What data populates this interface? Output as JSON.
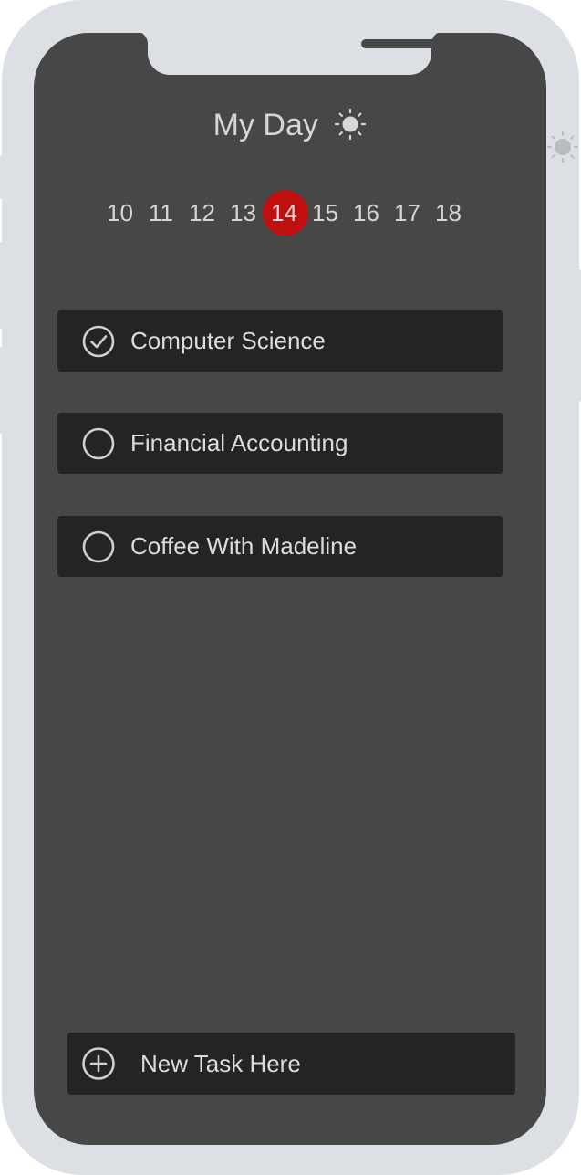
{
  "header": {
    "title": "My Day",
    "title_icon": "sun-icon"
  },
  "dates": {
    "days": [
      "10",
      "11",
      "12",
      "13",
      "14",
      "15",
      "16",
      "17",
      "18"
    ],
    "selected": "14",
    "selected_color": "#c00f0f"
  },
  "tasks": [
    {
      "label": "Computer Science",
      "done": true,
      "icon": "check-circle-icon"
    },
    {
      "label": "Financial Accounting",
      "done": false,
      "icon": "empty-circle-icon"
    },
    {
      "label": "Coffee With Madeline",
      "done": false,
      "icon": "empty-circle-icon"
    }
  ],
  "new_task": {
    "placeholder": "New Task Here",
    "icon": "plus-circle-icon"
  },
  "colors": {
    "screen_background": "#474747",
    "card_background": "#242424",
    "frame": "#dcdfe4",
    "text": "#d6d6d6"
  }
}
